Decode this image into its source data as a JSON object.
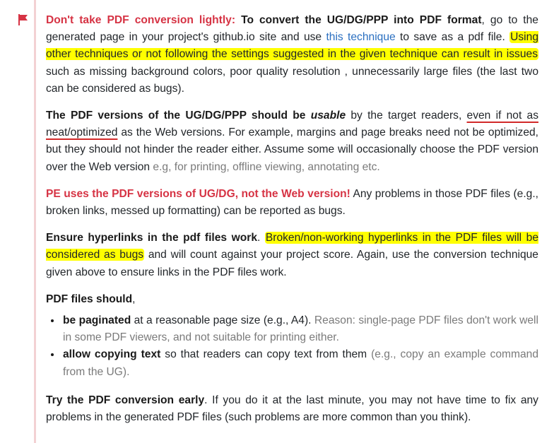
{
  "colors": {
    "accent_red": "#d63344",
    "highlight": "#ffff00",
    "link": "#2a6fc0",
    "muted": "#7a7a7a",
    "side_rule": "#f3d1d3"
  },
  "icons": {
    "flag": "flag-icon"
  },
  "p1": {
    "lead": "Don't take PDF conversion lightly:",
    "bold": "To convert the UG/DG/PPP into PDF format",
    "t1": ", go to the generated page in your project's github.io site and use ",
    "link": "this technique",
    "t2": " to save as a pdf file. ",
    "highlight": "Using other techniques or not following the settings suggested in the given technique can result in issues",
    "t3": " such as missing background colors, poor quality resolution , unnecessarily large files (the last two can be considered as bugs)."
  },
  "p2": {
    "bold1": "The PDF versions of the UG/DG/PPP should be ",
    "bold_italic": "usable",
    "t1": " by the target readers, ",
    "underlined": "even if not as neat/optimized",
    "t2": " as the Web versions. For example, margins and page breaks need not be optimized, but they should not hinder the reader either. Assume some will occasionally choose the PDF version over the Web version ",
    "muted": "e.g, for printing, offline viewing, annotating etc."
  },
  "p3": {
    "red": "PE uses the PDF versions of UG/DG, not the Web version!",
    "t1": " Any problems in those PDF files (e.g., broken links, messed up formatting) can be reported as bugs."
  },
  "p4": {
    "bold": "Ensure hyperlinks in the pdf files work",
    "t1": ". ",
    "highlight": "Broken/non-working hyperlinks in the PDF files will be considered as bugs",
    "t2": " and will count against your project score. Again, use the conversion technique given above to ensure links in the PDF files work."
  },
  "p5": {
    "bold": "PDF files should",
    "t1": ","
  },
  "list": [
    {
      "bold": "be paginated",
      "t1": " at a reasonable page size (e.g., A4). ",
      "muted": "Reason: single-page PDF files don't work well in some PDF viewers, and not suitable for printing either."
    },
    {
      "bold": "allow copying text",
      "t1": " so that readers can copy text from them ",
      "muted": "(e.g., copy an example command from the UG)."
    }
  ],
  "p6": {
    "bold": "Try the PDF conversion early",
    "t1": ". If you do it at the last minute, you may not have time to fix any problems in the generated PDF files (such problems are more common than you think)."
  }
}
